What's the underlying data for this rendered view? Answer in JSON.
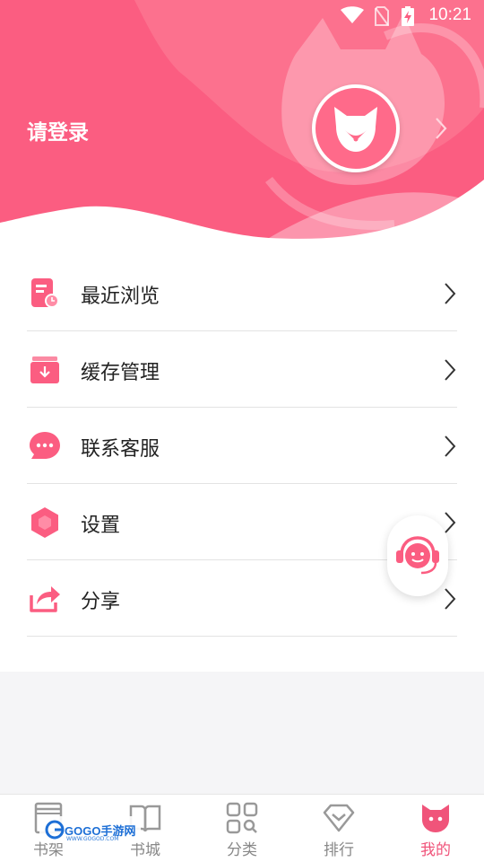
{
  "status_bar": {
    "time": "10:21",
    "icons": [
      "wifi-icon",
      "no-sim-icon",
      "battery-charging-icon"
    ]
  },
  "header": {
    "login_text": "请登录",
    "avatar_icon": "fox-icon",
    "chevron_icon": "chevron-right-icon",
    "colors": {
      "primary": "#fb5d81",
      "wave": "#ff8ca6"
    }
  },
  "menu": {
    "items": [
      {
        "label": "最近浏览",
        "icon": "recent-history-icon"
      },
      {
        "label": "缓存管理",
        "icon": "download-cache-icon"
      },
      {
        "label": "联系客服",
        "icon": "chat-bubble-icon"
      },
      {
        "label": "设置",
        "icon": "settings-hexagon-icon"
      },
      {
        "label": "分享",
        "icon": "share-icon"
      }
    ]
  },
  "floating_button": {
    "icon": "customer-service-icon"
  },
  "bottom_nav": {
    "items": [
      {
        "label": "书架",
        "icon": "bookshelf-icon",
        "active": false
      },
      {
        "label": "书城",
        "icon": "book-open-icon",
        "active": false
      },
      {
        "label": "分类",
        "icon": "category-grid-icon",
        "active": false
      },
      {
        "label": "排行",
        "icon": "ranking-icon",
        "active": false
      },
      {
        "label": "我的",
        "icon": "my-fox-icon",
        "active": true
      }
    ],
    "active_color": "#f0547a",
    "inactive_color": "#888888"
  },
  "watermark": {
    "text": "GOGO手游网",
    "sub": "WWW.GOGOD.COM"
  }
}
